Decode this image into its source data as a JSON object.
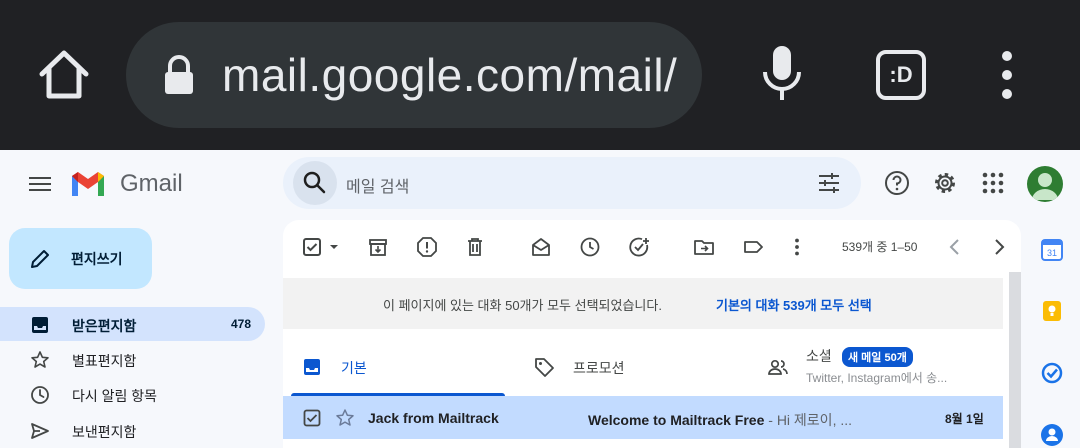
{
  "browser": {
    "url": "mail.google.com/mail/",
    "tab_label": ":D"
  },
  "app": {
    "name": "Gmail",
    "search_placeholder": "메일 검색"
  },
  "compose": {
    "label": "편지쓰기"
  },
  "nav": [
    {
      "label": "받은편지함",
      "count": "478",
      "icon": "inbox-icon"
    },
    {
      "label": "별표편지함",
      "count": "",
      "icon": "star-icon"
    },
    {
      "label": "다시 알림 항목",
      "count": "",
      "icon": "clock-icon"
    },
    {
      "label": "보낸편지함",
      "count": "",
      "icon": "send-icon"
    }
  ],
  "toolbar": {
    "pager": "539개 중 1–50"
  },
  "banner": {
    "text": "이 페이지에 있는 대화 50개가 모두 선택되었습니다.",
    "link": "기본의 대화 539개 모두 선택"
  },
  "tabs": [
    {
      "label": "기본",
      "icon": "inbox-icon"
    },
    {
      "label": "프로모션",
      "icon": "tag-icon"
    },
    {
      "label": "소셜",
      "icon": "people-icon",
      "badge": "새 메일 50개",
      "sub": "Twitter, Instagram에서 송..."
    }
  ],
  "emails": [
    {
      "sender": "Jack from Mailtrack",
      "subject": "Welcome to Mailtrack Free",
      "snippet": " - Hi 제로이, ...",
      "date": "8월 1일"
    }
  ],
  "colors": {
    "chrome_bg": "#202124",
    "accent": "#0b57d0",
    "compose_bg": "#c2e7ff",
    "selected_row": "#c2dbff"
  }
}
